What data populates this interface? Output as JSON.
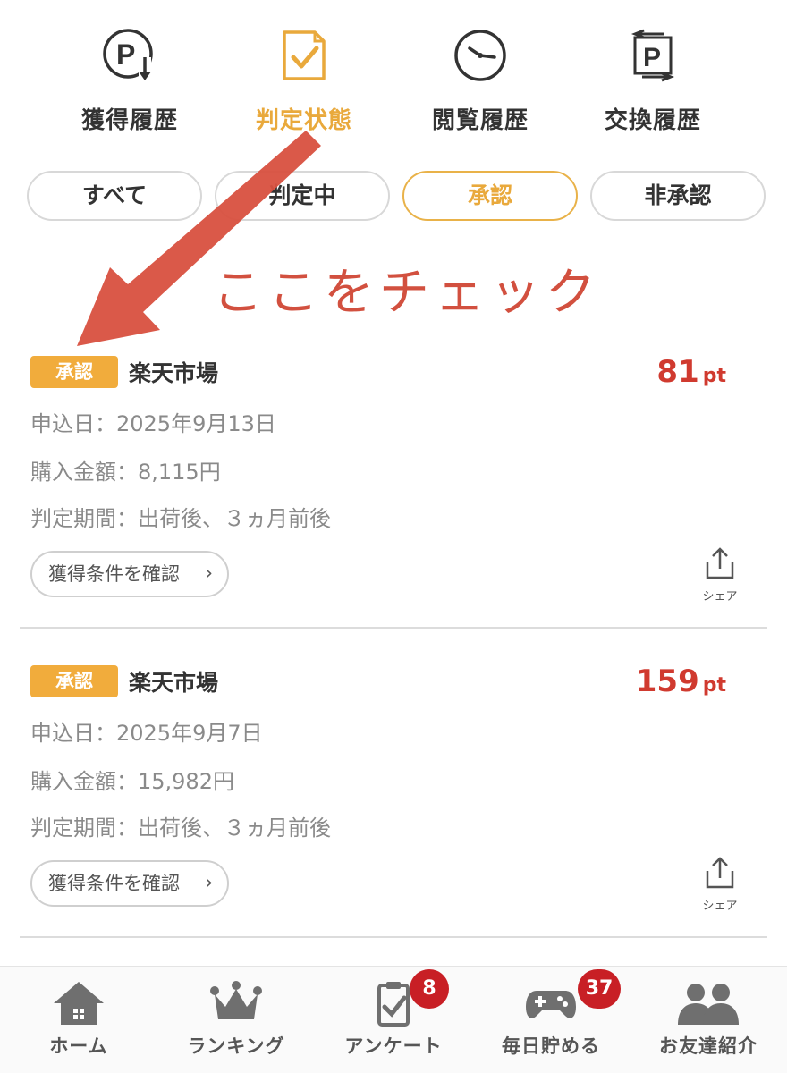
{
  "history_nav": [
    {
      "label": "獲得履歴",
      "icon": "point-download-icon"
    },
    {
      "label": "判定状態",
      "icon": "checked-document-icon"
    },
    {
      "label": "閲覧履歴",
      "icon": "clock-icon"
    },
    {
      "label": "交換履歴",
      "icon": "point-exchange-icon"
    }
  ],
  "active_nav": "判定状態",
  "filters": [
    "すべて",
    "判定中",
    "承認",
    "非承認"
  ],
  "active_filter": "承認",
  "annotation": {
    "text": "ここをチェック",
    "color": "#d2503f"
  },
  "records": [
    {
      "status": "承認",
      "shop": "楽天市場",
      "points": "81",
      "points_unit": "pt",
      "applied_date": "申込日：2025年9月13日",
      "purchase_amount": "購入金額：8,115円",
      "judgement_period": "判定期間：出荷後、３ヵ月前後",
      "condition_button": "獲得条件を確認",
      "share_label": "シェア"
    },
    {
      "status": "承認",
      "shop": "楽天市場",
      "points": "159",
      "points_unit": "pt",
      "applied_date": "申込日：2025年9月7日",
      "purchase_amount": "購入金額：15,982円",
      "judgement_period": "判定期間：出荷後、３ヵ月前後",
      "condition_button": "獲得条件を確認",
      "share_label": "シェア"
    }
  ],
  "tab_bar": [
    {
      "label": "ホーム",
      "icon": "home-icon"
    },
    {
      "label": "ランキング",
      "icon": "crown-icon"
    },
    {
      "label": "アンケート",
      "icon": "survey-clipboard-icon",
      "badge": "8"
    },
    {
      "label": "毎日貯める",
      "icon": "gamepad-icon",
      "badge": "37"
    },
    {
      "label": "お友達紹介",
      "icon": "friends-icon"
    }
  ],
  "colors": {
    "accent": "#e9a93c",
    "points": "#d03a2f",
    "badge": "#f1ac3c",
    "notification": "#c81f25"
  }
}
